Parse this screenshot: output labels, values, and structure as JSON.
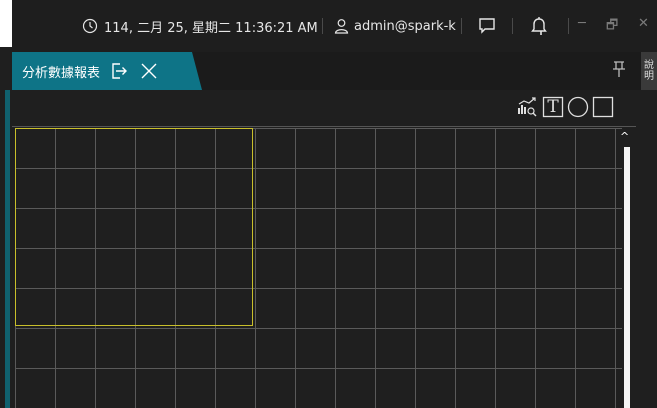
{
  "titlebar": {
    "datetime": "114, 二月 25, 星期二 11:36:21 AM",
    "user": "admin@spark-k",
    "clock_icon": "clock-icon",
    "user_icon": "user-icon",
    "chat_icon": "chat-icon",
    "bell_icon": "bell-icon",
    "minimize": "─",
    "restore": "🗗",
    "close": "✕"
  },
  "tab": {
    "label": "分析數據報表",
    "export_icon": "export-icon",
    "close_icon": "close-icon"
  },
  "side_panel": {
    "label_1": "說",
    "label_2": "明"
  },
  "toolbar": {
    "tools": [
      "chart-zoom-icon",
      "text-box-icon",
      "circle-icon",
      "rectangle-icon"
    ],
    "text_tool_glyph": "T"
  },
  "scrollbar": {
    "up_glyph": "^"
  },
  "colors": {
    "tab_accent": "#0e7487",
    "selection": "#c9bf2b",
    "grid": "#5a5a5a"
  }
}
